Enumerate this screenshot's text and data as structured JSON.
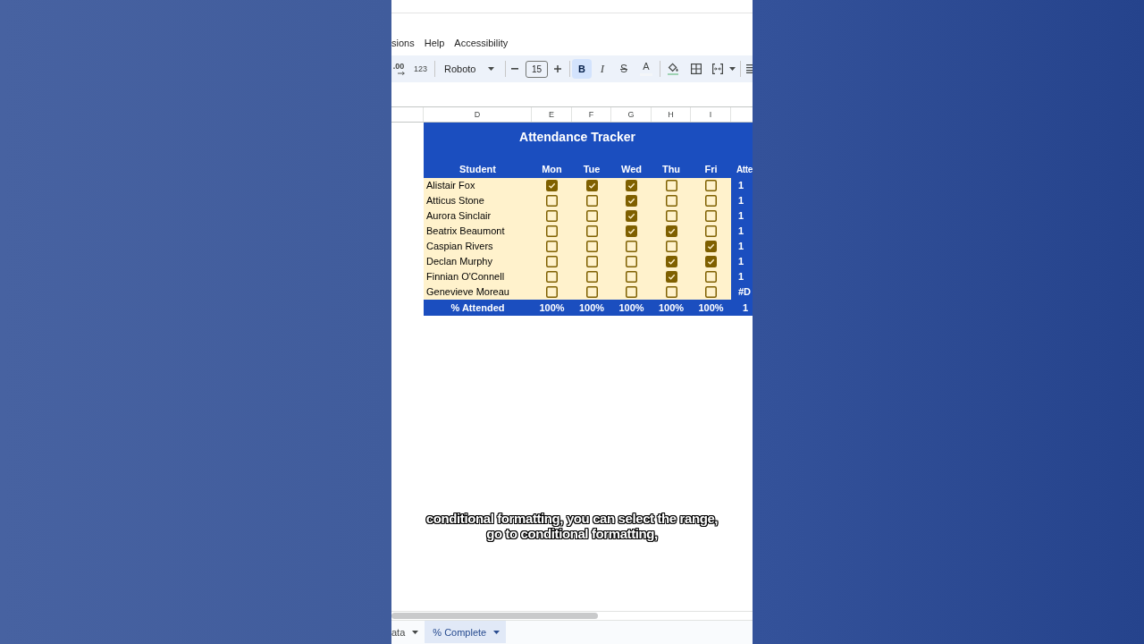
{
  "menu": [
    {
      "label": "sions"
    },
    {
      "label": "Help"
    },
    {
      "label": "Accessibility"
    }
  ],
  "toolbar": {
    "decimal_label": ".00",
    "number_format_label": "123",
    "font": "Roboto",
    "font_size": "15",
    "format_buttons": [
      {
        "kind": "bold",
        "label": "B",
        "on": true
      },
      {
        "kind": "italic",
        "label": "I",
        "on": false
      },
      {
        "kind": "strikethrough",
        "label": "S",
        "on": false
      },
      {
        "kind": "text-color",
        "label": "A",
        "on": false
      }
    ]
  },
  "sheet": {
    "column_headers": [
      "D",
      "E",
      "F",
      "G",
      "H",
      "I"
    ],
    "title": "Attendance Tracker",
    "header": {
      "student": "Student",
      "days": [
        "Mon",
        "Tue",
        "Wed",
        "Thu",
        "Fri"
      ],
      "column_7": "Atte"
    },
    "rows": [
      {
        "name": "Alistair Fox",
        "attendance": [
          {
            "checked": true
          },
          {
            "checked": true
          },
          {
            "checked": true
          },
          {
            "checked": false
          },
          {
            "checked": false
          }
        ],
        "column_7": "1"
      },
      {
        "name": "Atticus Stone",
        "attendance": [
          {
            "checked": false
          },
          {
            "checked": false
          },
          {
            "checked": true
          },
          {
            "checked": false
          },
          {
            "checked": false
          }
        ],
        "column_7": "1"
      },
      {
        "name": "Aurora Sinclair",
        "attendance": [
          {
            "checked": false
          },
          {
            "checked": false
          },
          {
            "checked": true
          },
          {
            "checked": false
          },
          {
            "checked": false
          }
        ],
        "column_7": "1"
      },
      {
        "name": "Beatrix Beaumont",
        "attendance": [
          {
            "checked": false
          },
          {
            "checked": false
          },
          {
            "checked": true
          },
          {
            "checked": true
          },
          {
            "checked": false
          }
        ],
        "column_7": "1"
      },
      {
        "name": "Caspian Rivers",
        "attendance": [
          {
            "checked": false
          },
          {
            "checked": false
          },
          {
            "checked": false
          },
          {
            "checked": false
          },
          {
            "checked": true
          }
        ],
        "column_7": "1"
      },
      {
        "name": "Declan Murphy",
        "attendance": [
          {
            "checked": false
          },
          {
            "checked": false
          },
          {
            "checked": false
          },
          {
            "checked": true
          },
          {
            "checked": true
          }
        ],
        "column_7": "1"
      },
      {
        "name": "Finnian O'Connell",
        "attendance": [
          {
            "checked": false
          },
          {
            "checked": false
          },
          {
            "checked": false
          },
          {
            "checked": true
          },
          {
            "checked": false
          }
        ],
        "column_7": "1"
      },
      {
        "name": "Genevieve Moreau",
        "attendance": [
          {
            "checked": false
          },
          {
            "checked": false
          },
          {
            "checked": false
          },
          {
            "checked": false
          },
          {
            "checked": false
          }
        ],
        "column_7": "#D"
      }
    ],
    "footer": {
      "label": "% Attended",
      "values": [
        "100%",
        "100%",
        "100%",
        "100%",
        "100%"
      ],
      "column_7": "1"
    }
  },
  "caption": {
    "lines": [
      "conditional formatting, you can select the range,",
      "go to conditional formatting,"
    ]
  },
  "sheet_tabs": [
    {
      "label": "ata",
      "selected": false
    },
    {
      "label": "% Complete",
      "selected": true
    }
  ]
}
